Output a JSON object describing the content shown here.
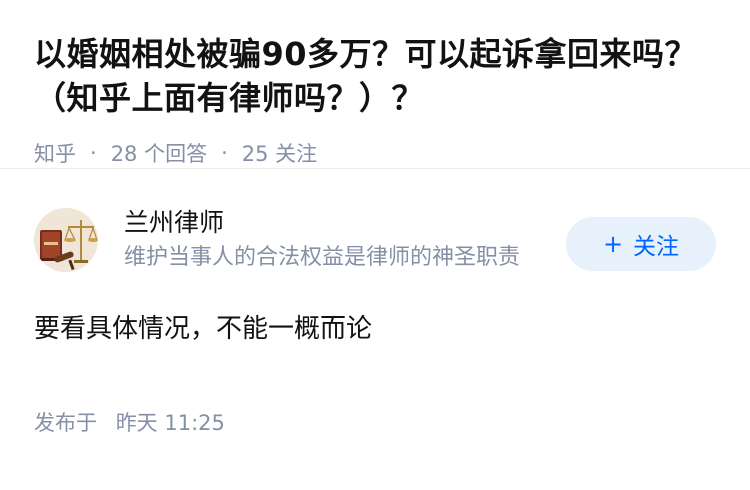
{
  "question": {
    "title": "以婚姻相处被骗90多万？可以起诉拿回来吗？（知乎上面有律师吗？）？",
    "source": "知乎",
    "answers_count": "28 个回答",
    "followers_count": "25 关注"
  },
  "answer": {
    "author_name": "兰州律师",
    "author_bio": "维护当事人的合法权益是律师的神圣职责",
    "follow_plus": "+",
    "follow_label": "关注",
    "content": "要看具体情况，不能一概而论",
    "published_label": "发布于",
    "published_time": "昨天 11:25"
  },
  "colors": {
    "accent": "#0066ff",
    "follow_bg": "#e7f1fb",
    "meta": "#8590a6",
    "text": "#121212"
  },
  "icons": {
    "avatar": "law-scales-gavel-avatar"
  }
}
